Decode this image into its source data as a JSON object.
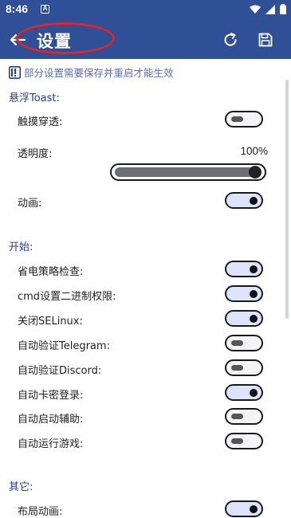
{
  "statusbar": {
    "time": "8:46",
    "notif_letter": "A"
  },
  "appbar": {
    "title": "设置",
    "back_icon": "arrow-left-icon",
    "refresh_icon": "refresh-icon",
    "save_icon": "save-icon"
  },
  "notice": {
    "icon": "warning-notice-icon",
    "text": "部分设置需要保存并重启才能生效"
  },
  "sections": {
    "toast": {
      "title": "悬浮Toast:",
      "touch_through": {
        "label": "触摸穿透:",
        "on": false
      },
      "opacity": {
        "label": "透明度:",
        "percent_text": "100%",
        "value": 1.0
      },
      "animation": {
        "label": "动画:",
        "on": true
      }
    },
    "start": {
      "title": "开始:",
      "items": [
        {
          "label": "省电策略检查:",
          "on": true
        },
        {
          "label": "cmd设置二进制权限:",
          "on": true
        },
        {
          "label": "关闭SELinux:",
          "on": true
        },
        {
          "label": "自动验证Telegram:",
          "on": false
        },
        {
          "label": "自动验证Discord:",
          "on": false
        },
        {
          "label": "自动卡密登录:",
          "on": true
        },
        {
          "label": "自动启动辅助:",
          "on": false
        },
        {
          "label": "自动运行游戏:",
          "on": false
        }
      ]
    },
    "other": {
      "title": "其它:",
      "layout_animation": {
        "label": "布局动画:",
        "on": true
      }
    }
  },
  "colors": {
    "appbar": "#2f4f97",
    "accent_text": "#2a3f86",
    "toggle_on_bg": "#dde3fb",
    "annotation": "#e0262c"
  }
}
